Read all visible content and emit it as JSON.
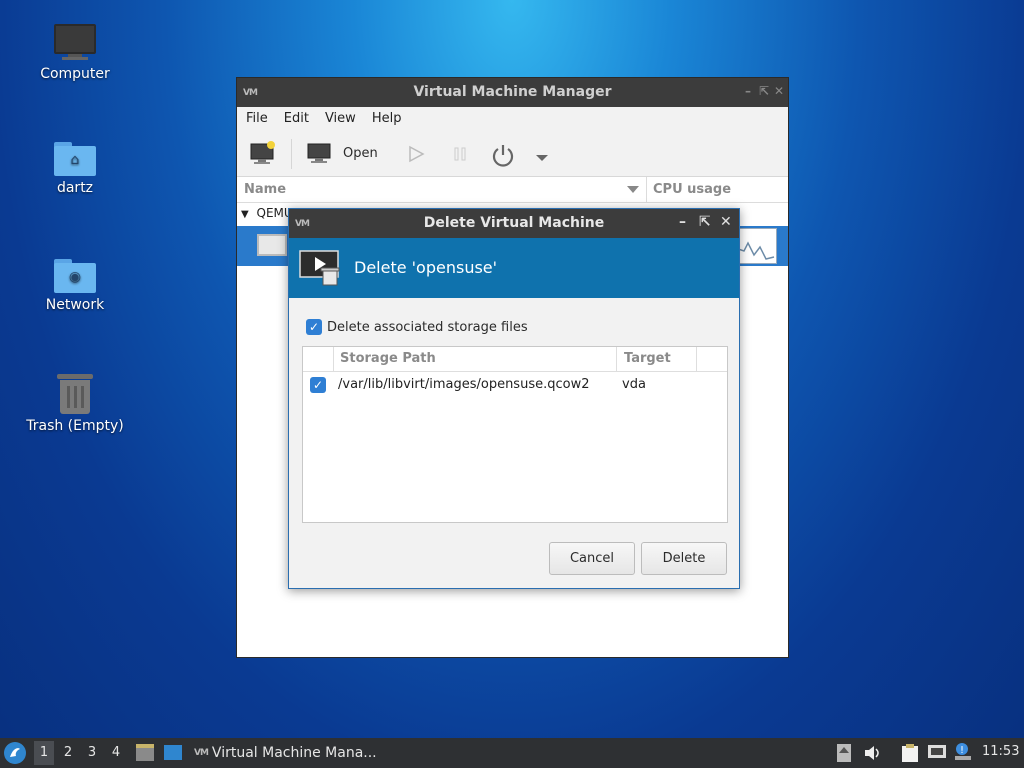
{
  "desktop": {
    "icons": [
      {
        "label": "Computer"
      },
      {
        "label": "dartz"
      },
      {
        "label": "Network"
      },
      {
        "label": "Trash (Empty)"
      }
    ]
  },
  "main_window": {
    "title": "Virtual Machine Manager",
    "menu": [
      "File",
      "Edit",
      "View",
      "Help"
    ],
    "toolbar": {
      "open_label": "Open"
    },
    "columns": {
      "name": "Name",
      "cpu": "CPU usage"
    },
    "group_label": "QEMU"
  },
  "dialog": {
    "title": "Delete Virtual Machine",
    "banner_text": "Delete 'opensuse'",
    "delete_storage_label": "Delete associated storage files",
    "delete_storage_checked": true,
    "columns": {
      "path": "Storage Path",
      "target": "Target"
    },
    "rows": [
      {
        "checked": true,
        "path": "/var/lib/libvirt/images/opensuse.qcow2",
        "target": "vda"
      }
    ],
    "cancel_label": "Cancel",
    "delete_label": "Delete"
  },
  "taskbar": {
    "workspaces": [
      "1",
      "2",
      "3",
      "4"
    ],
    "active_workspace": "1",
    "task_label": "Virtual Machine Mana...",
    "clock": "11:53"
  },
  "colors": {
    "banner": "#0f72ad",
    "selection": "#2a7acb",
    "taskbar": "#2e3033"
  }
}
